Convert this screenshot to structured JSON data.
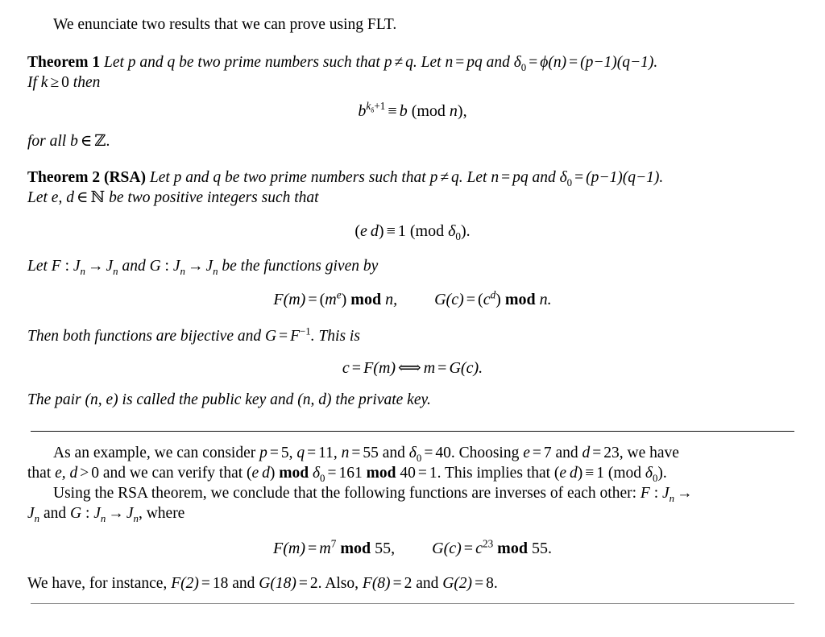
{
  "document": {
    "intro": {
      "text": "We enunciate two results that we can prove using FLT."
    },
    "theorem1": {
      "label": "Theorem 1",
      "statement_part1": "Let",
      "p": "p",
      "and1": "and",
      "q": "q",
      "statement_part2": "be two prime numbers such that",
      "neq_lhs": "p",
      "neq_symbol": "≠",
      "neq_rhs": "q",
      "statement_part3": "Let",
      "n": "n",
      "eq": "=",
      "pq": "pq",
      "and2": "and",
      "delta": "δ",
      "delta_sub": "0",
      "phi": "ϕ",
      "phi_arg": "(n)",
      "factored": "(p−1)(q−1).",
      "condition_if": "If",
      "condition_k": "k",
      "condition_geq": "≥",
      "condition_zero": "0",
      "condition_then": "then",
      "equation": {
        "base": "b",
        "exponent_k": "k",
        "exponent_delta": "δ",
        "exponent_delta_sub": "0",
        "exponent_plus_one": "+1",
        "congruent": "≡",
        "rhs": "b",
        "modulus_open": "(mod",
        "modulus_var": "n",
        "modulus_close": "),"
      },
      "closing_for_all": "for all",
      "closing_b": "b",
      "closing_in": "∈",
      "closing_set": "ℤ."
    },
    "theorem2": {
      "label": "Theorem 2 (RSA)",
      "statement_part1": "Let",
      "p": "p",
      "and1": "and",
      "q": "q",
      "statement_part2": "be two prime numbers such that",
      "neq_lhs": "p",
      "neq_symbol": "≠",
      "neq_rhs": "q",
      "statement_part3": "Let",
      "n": "n",
      "eq": "=",
      "pq": "pq",
      "and2": "and",
      "delta": "δ",
      "delta_sub": "0",
      "factored": "(p−1)(q−1).",
      "line2_let": "Let",
      "line2_ed": "e, d",
      "line2_in": "∈",
      "line2_set": "ℕ",
      "line2_rest": "be two positive integers such that",
      "equation_ed": {
        "lhs_open": "(",
        "lhs_e": "e",
        "lhs_d": "d",
        "lhs_close": ")",
        "congruent": "≡",
        "one": "1",
        "modulus_open": "(mod",
        "modulus_delta": "δ",
        "modulus_delta_sub": "0",
        "modulus_close": ")."
      },
      "functions_intro": {
        "let": "Let",
        "F": "F",
        "colon": ":",
        "J": "J",
        "J_sub": "n",
        "arrow": "→",
        "and": "and",
        "G": "G",
        "rest": "be the functions given by"
      },
      "equation_FG": {
        "F": "F",
        "F_arg": "(m)",
        "eq": "=",
        "F_open": "(",
        "F_base": "m",
        "F_exp": "e",
        "F_close": ")",
        "mod": "mod",
        "F_mod": "n,",
        "G": "G",
        "G_arg": "(c)",
        "G_open": "(",
        "G_base": "c",
        "G_exp": "d",
        "G_close": ")",
        "G_mod": "n."
      },
      "bijective": {
        "text1": "Then both functions are bijective and",
        "G": "G",
        "eq": "=",
        "F": "F",
        "inv": "−1",
        "text2": ". This is"
      },
      "equation_equiv": {
        "c": "c",
        "eq1": "=",
        "F": "F",
        "F_arg": "(m)",
        "iff": "⟺",
        "m": "m",
        "eq2": "=",
        "G": "G",
        "G_arg": "(c)."
      },
      "keys": {
        "text1": "The pair",
        "public": "(n, e)",
        "text2": "is called the public key and",
        "private": "(n, d)",
        "text3": "the private key."
      }
    },
    "example": {
      "line1_a": "As an example, we can consider",
      "p_eq": "p",
      "p_val": "5,",
      "q_eq": "q",
      "q_val": "11,",
      "n_eq": "n",
      "n_val": "55",
      "and": "and",
      "delta": "δ",
      "delta_sub": "0",
      "delta_val": "40.",
      "choosing": "Choosing",
      "e": "e",
      "e_val": "7",
      "and2": "and",
      "d": "d",
      "d_val": "23,",
      "we_have": "we have",
      "line2_that": "that",
      "ed": "e, d",
      "gt": ">",
      "zero": "0",
      "line2_mid": "and we can verify that",
      "ed_paren_open": "(",
      "ed_e": "e",
      "ed_d": "d",
      "ed_paren_close": ")",
      "mod": "mod",
      "mod_delta": "δ",
      "mod_delta_sub": "0",
      "eq1": "=",
      "val161": "161",
      "mod2": "mod",
      "val40": "40",
      "eq2": "=",
      "val1": "1.",
      "implies": "This implies that",
      "implies_open": "(",
      "implies_e": "e",
      "implies_d": "d",
      "implies_close": ")",
      "congruent": "≡",
      "congruent_one": "1",
      "congruent_mod_open": "(mod",
      "congruent_delta": "δ",
      "congruent_delta_sub": "0",
      "congruent_close": ").",
      "line3_a": "Using the RSA theorem, we conclude that the following functions are inverses of each other:",
      "line3_F": "F",
      "line3_colon": ":",
      "line3_J": "J",
      "line3_J_sub": "n",
      "line3_arrow": "→",
      "line4_J": "J",
      "line4_J_sub": "n",
      "line4_and": "and",
      "line4_G": "G",
      "line4_colon": ":",
      "line4_J2": "J",
      "line4_J2_sub": "n",
      "line4_arrow": "→",
      "line4_J3": "J",
      "line4_J3_sub": "n",
      "line4_where": ", where",
      "equation_concrete": {
        "F": "F",
        "F_arg": "(m)",
        "eq": "=",
        "m": "m",
        "m_exp": "7",
        "mod": "mod",
        "mod_val": "55,",
        "G": "G",
        "G_arg": "(c)",
        "c": "c",
        "c_exp": "23",
        "G_mod_val": "55."
      },
      "final": {
        "text1": "We have, for instance,",
        "F2": "F",
        "F2_arg": "(2)",
        "eq1": "=",
        "v18": "18",
        "and1": "and",
        "G18": "G",
        "G18_arg": "(18)",
        "eq2": "=",
        "v2": "2.",
        "also": "Also,",
        "F8": "F",
        "F8_arg": "(8)",
        "eq3": "=",
        "v2b": "2",
        "and2": "and",
        "G2": "G",
        "G2_arg": "(2)",
        "eq4": "=",
        "v8": "8."
      }
    }
  }
}
